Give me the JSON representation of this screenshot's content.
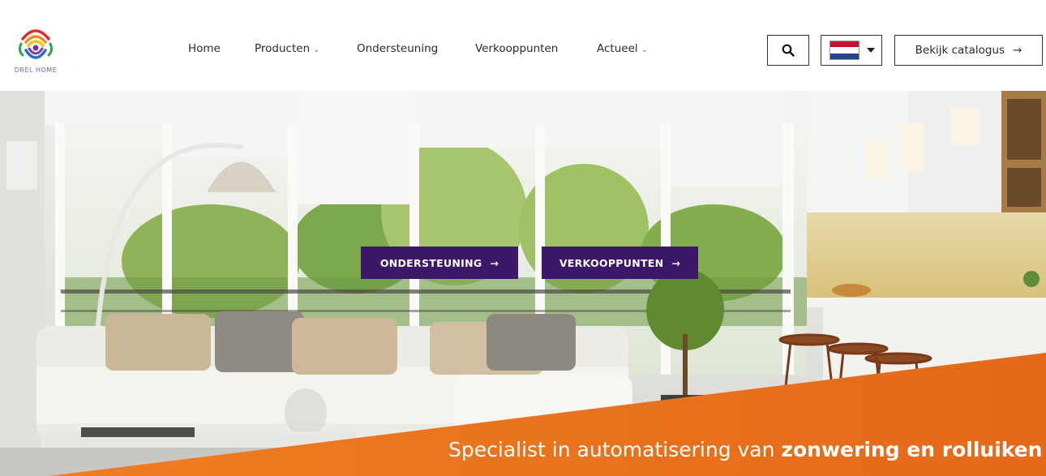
{
  "brand": {
    "logo_text": "DREL HOME"
  },
  "nav": {
    "items": [
      {
        "label": "Home",
        "dropdown": false
      },
      {
        "label": "Producten",
        "dropdown": true
      },
      {
        "label": "Ondersteuning",
        "dropdown": false
      },
      {
        "label": "Verkooppunten",
        "dropdown": false
      },
      {
        "label": "Actueel",
        "dropdown": true
      }
    ],
    "chevron": "⌄"
  },
  "header_actions": {
    "search_icon": "search-icon",
    "language": {
      "flag": "netherlands-flag",
      "selected": "NL"
    },
    "catalog_label": "Bekijk catalogus",
    "catalog_arrow": "→"
  },
  "hero": {
    "buttons": [
      {
        "label": "ONDERSTEUNING",
        "arrow": "→"
      },
      {
        "label": "VERKOOPPUNTEN",
        "arrow": "→"
      }
    ],
    "tagline_plain": "Specialist in automatisering van ",
    "tagline_bold": "zonwering en rolluiken"
  },
  "colors": {
    "accent_purple": "#3d1768",
    "accent_orange": "#e8741e",
    "header_bg": "#ffffff"
  }
}
